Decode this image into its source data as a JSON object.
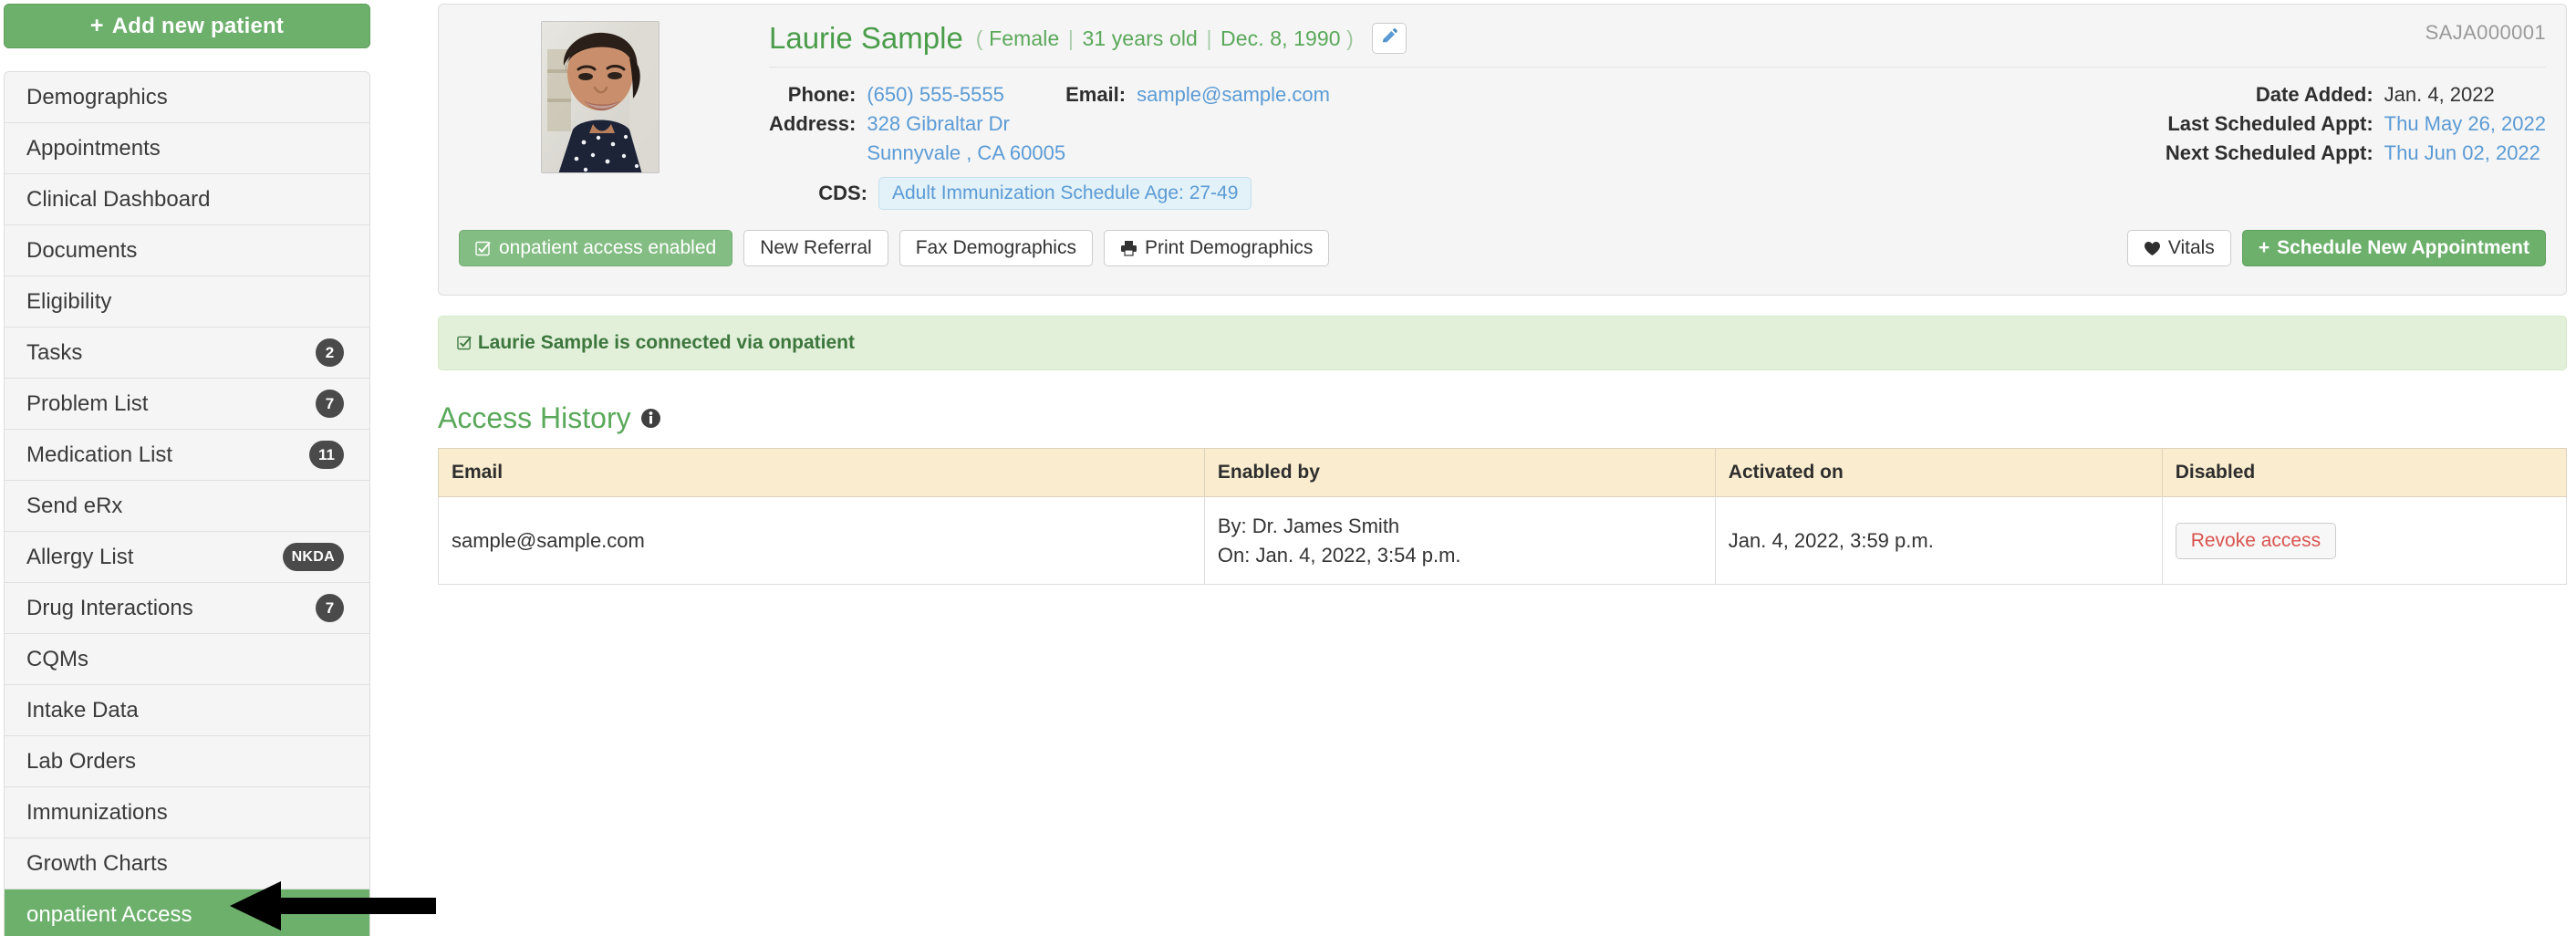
{
  "sidebar": {
    "add_patient_label": "Add new patient",
    "add_patient_plus": "+",
    "items": [
      {
        "label": "Demographics",
        "badge": "",
        "active": false
      },
      {
        "label": "Appointments",
        "badge": "",
        "active": false
      },
      {
        "label": "Clinical Dashboard",
        "badge": "",
        "active": false
      },
      {
        "label": "Documents",
        "badge": "",
        "active": false
      },
      {
        "label": "Eligibility",
        "badge": "",
        "active": false
      },
      {
        "label": "Tasks",
        "badge": "2",
        "active": false
      },
      {
        "label": "Problem List",
        "badge": "7",
        "active": false
      },
      {
        "label": "Medication List",
        "badge": "11",
        "active": false
      },
      {
        "label": "Send eRx",
        "badge": "",
        "active": false
      },
      {
        "label": "Allergy List",
        "badge": "NKDA",
        "active": false
      },
      {
        "label": "Drug Interactions",
        "badge": "7",
        "active": false
      },
      {
        "label": "CQMs",
        "badge": "",
        "active": false
      },
      {
        "label": "Intake Data",
        "badge": "",
        "active": false
      },
      {
        "label": "Lab Orders",
        "badge": "",
        "active": false
      },
      {
        "label": "Immunizations",
        "badge": "",
        "active": false
      },
      {
        "label": "Growth Charts",
        "badge": "",
        "active": false
      },
      {
        "label": "onpatient Access",
        "badge": "",
        "active": true
      }
    ]
  },
  "patient": {
    "chart_id": "SAJA000001",
    "name": "Laurie Sample",
    "paren_open": "(",
    "paren_close": ")",
    "sex": "Female",
    "age": "31 years old",
    "dob": "Dec. 8, 1990",
    "separator": "|",
    "edit_tooltip": "Edit",
    "phone_label": "Phone:",
    "phone_value": "(650) 555-5555",
    "email_label": "Email:",
    "email_value": "sample@sample.com",
    "address_label": "Address:",
    "address_line1": "328 Gibraltar Dr",
    "address_line2": "Sunnyvale , CA 60005",
    "cds_label": "CDS:",
    "cds_value": "Adult Immunization Schedule Age: 27-49",
    "date_added_label": "Date Added:",
    "date_added_value": "Jan. 4, 2022",
    "last_appt_label": "Last Scheduled Appt:",
    "last_appt_value": "Thu May 26, 2022",
    "next_appt_label": "Next Scheduled Appt:",
    "next_appt_value": "Thu Jun 02, 2022"
  },
  "actions": {
    "onpatient_enabled": "onpatient access enabled",
    "new_referral": "New Referral",
    "fax_demographics": "Fax Demographics",
    "print_demographics": "Print Demographics",
    "vitals": "Vitals",
    "schedule_new_appointment": "Schedule New Appointment",
    "schedule_plus": "+"
  },
  "alert": {
    "text": "Laurie Sample is connected via onpatient"
  },
  "access_history": {
    "title": "Access History",
    "columns": [
      "Email",
      "Enabled by",
      "Activated on",
      "Disabled"
    ],
    "rows": [
      {
        "email": "sample@sample.com",
        "enabled_by_prefix": "By:",
        "enabled_by_name": "Dr. James Smith",
        "enabled_on_prefix": "On:",
        "enabled_on_value": "Jan. 4, 2022, 3:54 p.m.",
        "activated_on": "Jan. 4, 2022, 3:59 p.m.",
        "disabled_action": "Revoke access"
      }
    ]
  },
  "colors": {
    "brand_green": "#6cb06c",
    "name_green": "#4a9d4a",
    "link_blue": "#5b9bd5",
    "table_header": "#faecce",
    "alert_bg": "#e2f0da",
    "danger_red": "#d9534f"
  }
}
